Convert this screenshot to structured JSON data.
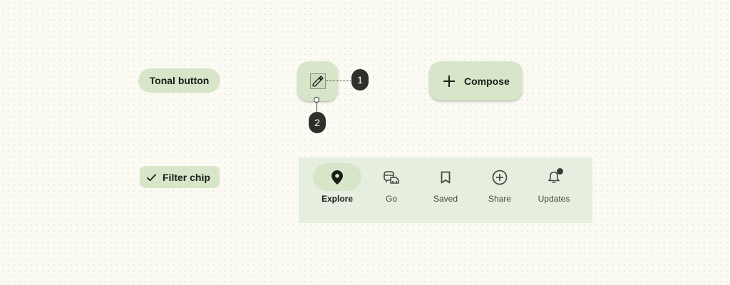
{
  "tonal_button": {
    "label": "Tonal button"
  },
  "fab": {
    "icon": "pencil-icon"
  },
  "callouts": [
    {
      "number": "1"
    },
    {
      "number": "2"
    }
  ],
  "extended_fab": {
    "label": "Compose",
    "icon": "plus-icon"
  },
  "filter_chip": {
    "label": "Filter chip",
    "icon": "check-icon",
    "selected": true
  },
  "navigation": {
    "items": [
      {
        "label": "Explore",
        "icon": "location-pin-icon",
        "active": true
      },
      {
        "label": "Go",
        "icon": "commute-icon",
        "active": false
      },
      {
        "label": "Saved",
        "icon": "bookmark-icon",
        "active": false
      },
      {
        "label": "Share",
        "icon": "add-circle-icon",
        "active": false
      },
      {
        "label": "Updates",
        "icon": "notifications-icon",
        "active": false,
        "badge": true
      }
    ]
  },
  "colors": {
    "container": "#d7e6c9",
    "nav_background": "#e6eee0",
    "on_surface": "#1b1c17",
    "marker": "#2f302c"
  }
}
